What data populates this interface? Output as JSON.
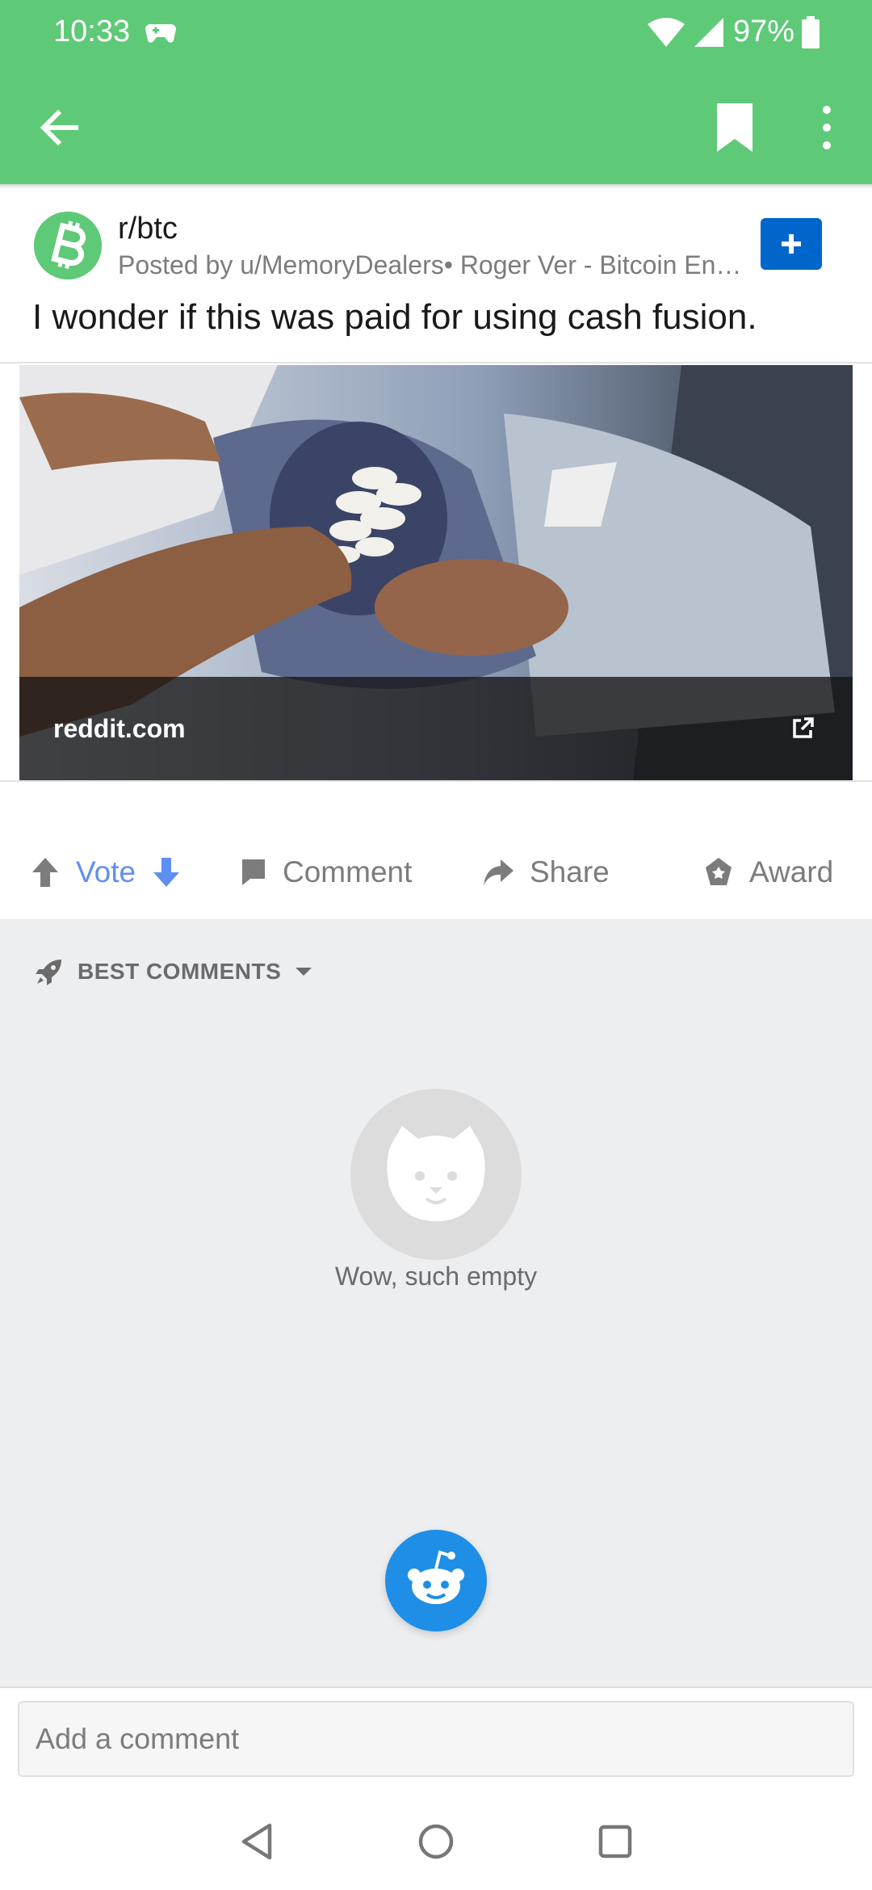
{
  "status_bar": {
    "time": "10:33",
    "battery": "97%"
  },
  "toolbar": {
    "back_icon": "arrow-left-icon",
    "bookmark_icon": "bookmark-icon",
    "more_icon": "more-vert-icon"
  },
  "post": {
    "subreddit": "r/btc",
    "byline": "Posted by u/MemoryDealers• Roger Ver - Bitcoin Entr…",
    "title": "I wonder if this was paid for using cash fusion.",
    "link_domain": "reddit.com"
  },
  "actions": {
    "vote_label": "Vote",
    "comment_label": "Comment",
    "share_label": "Share",
    "award_label": "Award"
  },
  "comments": {
    "sort_label": "BEST COMMENTS",
    "empty_text": "Wow, such empty"
  },
  "comment_box": {
    "placeholder": "Add a comment",
    "value": ""
  },
  "colors": {
    "header_green": "#5ec977",
    "accent_blue": "#0066cc",
    "vote_blue": "#5f8ff0",
    "fab_blue": "#1e8ee6"
  }
}
